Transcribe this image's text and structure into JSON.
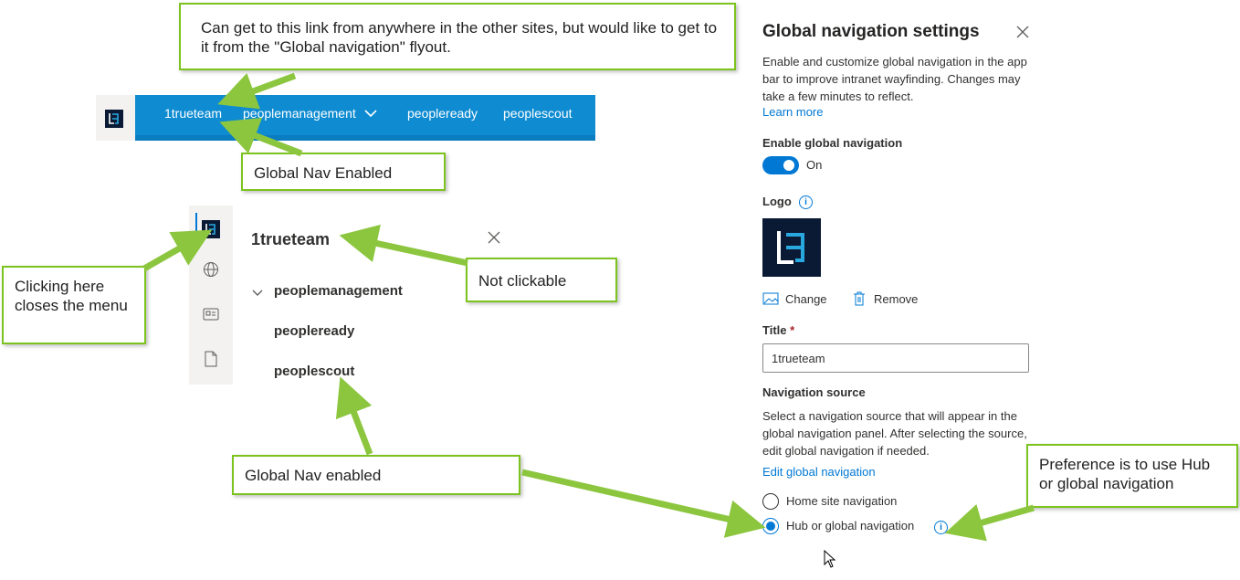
{
  "hub_nav": {
    "items": [
      "1trueteam",
      "peoplemanagement",
      "peopleready",
      "peoplescout"
    ],
    "dropdown_icon": "chevron-down-icon"
  },
  "flyout": {
    "title": "1trueteam",
    "items": [
      "peoplemanagement",
      "peopleready",
      "peoplescout"
    ],
    "rail_icons": [
      "site-logo-icon",
      "globe-icon",
      "news-icon",
      "document-icon"
    ],
    "close_icon": "close-icon"
  },
  "callouts": {
    "top": "Can get to this link from anywhere in the other sites, but would like to get to it from the \"Global navigation\" flyout.",
    "global_nav_enabled": "Global Nav Enabled",
    "clicking_here": "Clicking here closes the menu",
    "not_clickable": "Not clickable",
    "global_nav_enabled_2": "Global Nav enabled",
    "preference": "Preference is to use Hub or global navigation"
  },
  "panel": {
    "title": "Global navigation settings",
    "description": "Enable and customize global navigation in the app bar to improve intranet wayfinding. Changes may take a few minutes to reflect.",
    "learn_more": "Learn more",
    "enable_label": "Enable global navigation",
    "toggle_state": "On",
    "logo_label": "Logo",
    "change_label": "Change",
    "remove_label": "Remove",
    "title_label": "Title",
    "required_mark": "*",
    "title_value": "1trueteam",
    "nav_source_label": "Navigation source",
    "nav_source_desc": "Select a navigation source that will appear in the global navigation panel. After selecting the source, edit global navigation if needed.",
    "edit_link": "Edit global navigation",
    "radio_options": [
      "Home site navigation",
      "Hub or global navigation"
    ],
    "selected_option": "Hub or global navigation"
  },
  "colors": {
    "hub_bar": "#0e8bd1",
    "accent": "#0078d4",
    "callout_border": "#7cc31f",
    "arrow": "#8cc63f"
  }
}
